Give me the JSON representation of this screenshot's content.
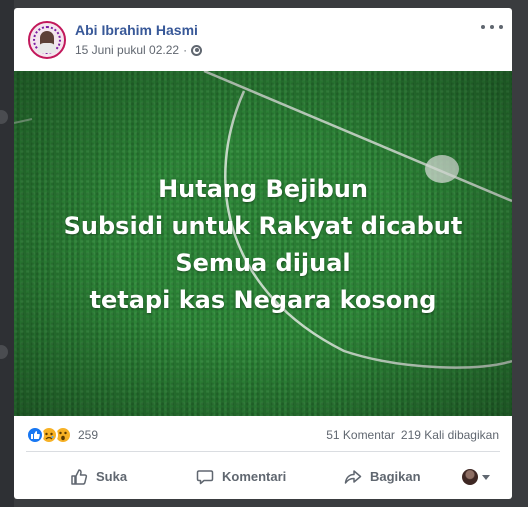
{
  "post": {
    "author": "Abi Ibrahim Hasmi",
    "date": "15 Juni pukul 02.22",
    "separator": "·",
    "privacy_icon": "globe-icon",
    "more_icon": "more-icon"
  },
  "image": {
    "text_lines": [
      "Hutang Bejibun",
      "Subsidi untuk Rakyat dicabut",
      "Semua dijual",
      "tetapi kas Negara kosong"
    ]
  },
  "stats": {
    "reactions": [
      "like",
      "sad",
      "wow"
    ],
    "reaction_count": "259",
    "comments": "51 Komentar",
    "shares": "219 Kali dibagikan"
  },
  "actions": {
    "like_label": "Suka",
    "comment_label": "Komentari",
    "share_label": "Bagikan"
  },
  "colors": {
    "author_link": "#385898",
    "like_blue": "#1877f2",
    "field_green": "#2d8437",
    "muted_text": "#606770"
  }
}
